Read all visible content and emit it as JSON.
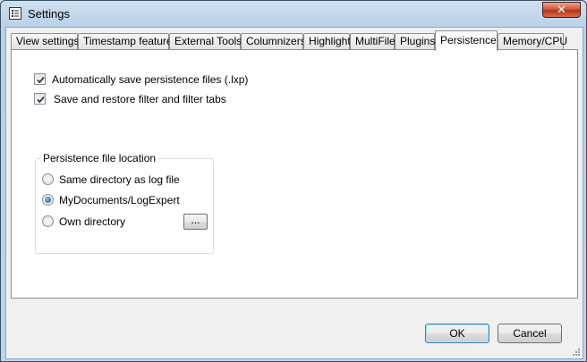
{
  "window": {
    "title": "Settings"
  },
  "tabs": [
    {
      "label": "View settings"
    },
    {
      "label": "Timestamp features"
    },
    {
      "label": "External Tools"
    },
    {
      "label": "Columnizers"
    },
    {
      "label": "Highlight"
    },
    {
      "label": "MultiFile"
    },
    {
      "label": "Plugins"
    },
    {
      "label": "Persistence",
      "active": true
    },
    {
      "label": "Memory/CPU"
    }
  ],
  "persistence": {
    "auto_save": {
      "label": "Automatically save persistence files (.lxp)",
      "checked": true
    },
    "save_filters": {
      "label": "Save and restore filter and filter tabs",
      "checked": true
    },
    "location": {
      "title": "Persistence file location",
      "options": [
        {
          "label": "Same directory as log file",
          "selected": false
        },
        {
          "label": "MyDocuments/LogExpert",
          "selected": true
        },
        {
          "label": "Own directory",
          "selected": false
        }
      ],
      "browse_label": "..."
    }
  },
  "buttons": {
    "ok": "OK",
    "cancel": "Cancel"
  }
}
